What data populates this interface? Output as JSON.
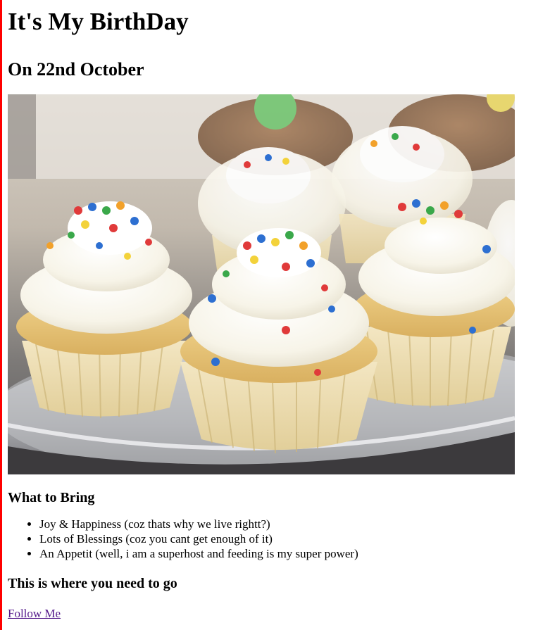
{
  "page": {
    "title": "It's My BirthDay",
    "subtitle": "On 22nd October",
    "image_alt": "cupcakes-with-sprinkles",
    "bring": {
      "heading": "What to Bring",
      "items": [
        "Joy & Happiness (coz thats why we live rightt?)",
        "Lots of Blessings (coz you cant get enough of it)",
        "An Appetit (well, i am a superhost and feeding is my super power)"
      ]
    },
    "location": {
      "heading": "This is where you need to go",
      "link_label": "Follow Me"
    }
  },
  "colors": {
    "border": "#ff0000",
    "link": "#551a8b"
  }
}
